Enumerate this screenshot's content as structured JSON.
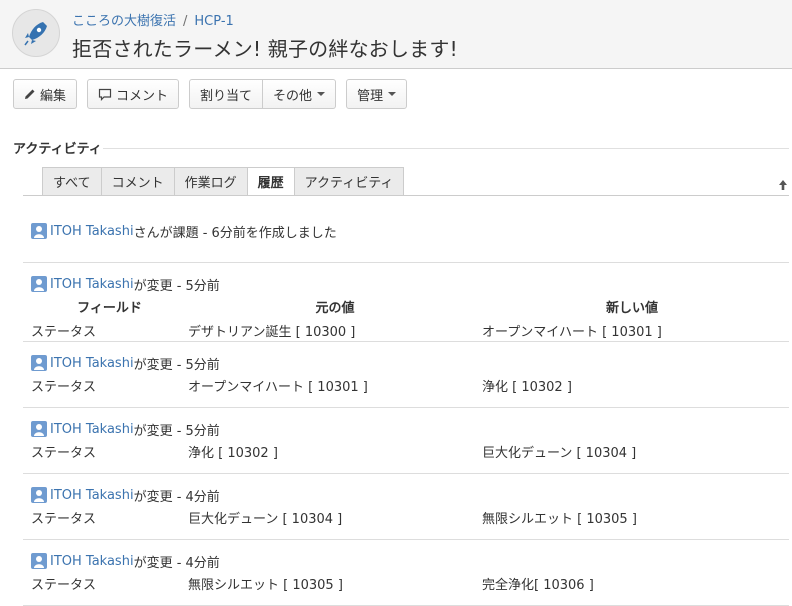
{
  "breadcrumb": {
    "project": "こころの大樹復活",
    "separator": "/",
    "issue_key": "HCP-1"
  },
  "title": "拒否されたラーメン! 親子の絆なおします!",
  "toolbar": {
    "edit": "編集",
    "comment": "コメント",
    "assign": "割り当て",
    "more": "その他",
    "admin": "管理"
  },
  "activity": {
    "heading": "アクティビティ",
    "tabs": [
      "すべて",
      "コメント",
      "作業ログ",
      "履歴",
      "アクティビティ"
    ],
    "active_tab": "履歴",
    "created": {
      "user": "ITOH Takashi",
      "text": "さんが課題 - 6分前を作成しました"
    },
    "headers": {
      "field": "フィールド",
      "old": "元の値",
      "new": "新しい値"
    },
    "changes": [
      {
        "user": "ITOH Takashi",
        "action": "が変更 - 5分前",
        "field": "ステータス",
        "old": "デザトリアン誕生 [ 10300 ]",
        "new": "オープンマイハート [ 10301 ]"
      },
      {
        "user": "ITOH Takashi",
        "action": "が変更 - 5分前",
        "field": "ステータス",
        "old": "オープンマイハート [ 10301 ]",
        "new": "浄化 [ 10302 ]"
      },
      {
        "user": "ITOH Takashi",
        "action": "が変更 - 5分前",
        "field": "ステータス",
        "old": "浄化 [ 10302 ]",
        "new": "巨大化デューン [ 10304 ]"
      },
      {
        "user": "ITOH Takashi",
        "action": "が変更 - 4分前",
        "field": "ステータス",
        "old": "巨大化デューン [ 10304 ]",
        "new": "無限シルエット [ 10305 ]"
      },
      {
        "user": "ITOH Takashi",
        "action": "が変更 - 4分前",
        "field": "ステータス",
        "old": "無限シルエット [ 10305 ]",
        "new": "完全浄化[ 10306 ]"
      }
    ]
  },
  "colors": {
    "link": "#3b73af",
    "header_bg": "#f5f5f5",
    "tab_bg": "#ebebeb"
  }
}
